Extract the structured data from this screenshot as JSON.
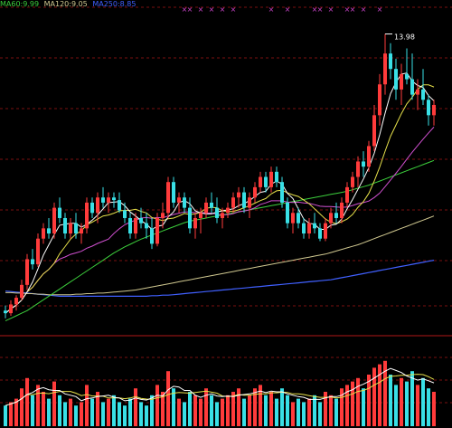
{
  "legend": {
    "ma60": "MA60:9.99",
    "ma120": "MA120:9.05",
    "ma250": "MA250:8.85"
  },
  "colors": {
    "background": "#000000",
    "grid": "#7a1010",
    "divider": "#b01818",
    "up": "#ff3b3b",
    "down": "#39e0e6",
    "ma5": "#ffffff",
    "ma10": "#e6e04a",
    "ma20": "#d050d0",
    "ma60": "#3ccf3c",
    "ma120": "#d0c890",
    "ma250": "#4060ff",
    "marker": "#cc44cc"
  },
  "chart_data": {
    "type": "candlestick",
    "peak_label": "13.98",
    "ylim": [
      8.2,
      14.5
    ],
    "candles": [
      [
        8.6,
        8.7,
        8.45,
        8.55
      ],
      [
        8.55,
        8.8,
        8.5,
        8.72
      ],
      [
        8.72,
        8.9,
        8.6,
        8.85
      ],
      [
        8.85,
        9.2,
        8.8,
        9.1
      ],
      [
        9.1,
        9.7,
        9.0,
        9.6
      ],
      [
        9.6,
        9.8,
        9.4,
        9.5
      ],
      [
        9.5,
        10.1,
        9.45,
        10.0
      ],
      [
        10.0,
        10.3,
        9.9,
        10.2
      ],
      [
        10.2,
        10.4,
        10.0,
        10.1
      ],
      [
        10.1,
        10.7,
        10.0,
        10.6
      ],
      [
        10.6,
        10.8,
        10.3,
        10.4
      ],
      [
        10.4,
        10.5,
        10.0,
        10.1
      ],
      [
        10.1,
        10.4,
        10.0,
        10.3
      ],
      [
        10.3,
        10.5,
        10.0,
        10.1
      ],
      [
        10.1,
        10.3,
        9.9,
        10.2
      ],
      [
        10.2,
        10.8,
        10.1,
        10.7
      ],
      [
        10.7,
        10.8,
        10.4,
        10.5
      ],
      [
        10.5,
        10.9,
        10.3,
        10.8
      ],
      [
        10.8,
        11.0,
        10.6,
        10.7
      ],
      [
        10.7,
        10.9,
        10.5,
        10.8
      ],
      [
        10.8,
        10.9,
        10.6,
        10.75
      ],
      [
        10.75,
        10.9,
        10.5,
        10.55
      ],
      [
        10.55,
        10.7,
        10.3,
        10.4
      ],
      [
        10.4,
        10.5,
        10.0,
        10.1
      ],
      [
        10.1,
        10.5,
        10.0,
        10.4
      ],
      [
        10.4,
        10.6,
        10.2,
        10.3
      ],
      [
        10.3,
        10.5,
        10.0,
        10.2
      ],
      [
        10.2,
        10.4,
        9.8,
        9.9
      ],
      [
        9.9,
        10.5,
        9.85,
        10.4
      ],
      [
        10.4,
        10.7,
        10.2,
        10.5
      ],
      [
        10.5,
        11.2,
        10.4,
        11.1
      ],
      [
        11.1,
        11.2,
        10.6,
        10.7
      ],
      [
        10.7,
        10.9,
        10.5,
        10.8
      ],
      [
        10.8,
        10.9,
        10.5,
        10.6
      ],
      [
        10.6,
        10.8,
        10.1,
        10.2
      ],
      [
        10.2,
        10.5,
        10.0,
        10.4
      ],
      [
        10.4,
        10.6,
        10.1,
        10.5
      ],
      [
        10.5,
        10.8,
        10.4,
        10.7
      ],
      [
        10.7,
        10.9,
        10.5,
        10.6
      ],
      [
        10.6,
        10.8,
        10.3,
        10.4
      ],
      [
        10.4,
        10.6,
        10.2,
        10.5
      ],
      [
        10.5,
        10.7,
        10.4,
        10.6
      ],
      [
        10.6,
        10.9,
        10.5,
        10.8
      ],
      [
        10.8,
        11.0,
        10.6,
        10.9
      ],
      [
        10.9,
        11.0,
        10.5,
        10.6
      ],
      [
        10.6,
        10.9,
        10.4,
        10.8
      ],
      [
        10.8,
        11.1,
        10.7,
        11.0
      ],
      [
        11.0,
        11.3,
        10.9,
        11.2
      ],
      [
        11.2,
        11.3,
        10.9,
        11.0
      ],
      [
        11.0,
        11.4,
        10.9,
        11.3
      ],
      [
        11.3,
        11.4,
        11.0,
        11.1
      ],
      [
        11.1,
        11.2,
        10.6,
        10.7
      ],
      [
        10.7,
        10.8,
        10.2,
        10.3
      ],
      [
        10.3,
        10.6,
        10.1,
        10.5
      ],
      [
        10.5,
        10.6,
        10.2,
        10.3
      ],
      [
        10.3,
        10.4,
        10.0,
        10.1
      ],
      [
        10.1,
        10.4,
        10.0,
        10.3
      ],
      [
        10.3,
        10.5,
        10.1,
        10.2
      ],
      [
        10.2,
        10.3,
        9.95,
        10.0
      ],
      [
        10.0,
        10.4,
        9.95,
        10.3
      ],
      [
        10.3,
        10.6,
        10.2,
        10.5
      ],
      [
        10.5,
        10.7,
        10.3,
        10.4
      ],
      [
        10.4,
        10.8,
        10.3,
        10.7
      ],
      [
        10.7,
        11.1,
        10.6,
        11.0
      ],
      [
        11.0,
        11.3,
        10.9,
        11.2
      ],
      [
        11.2,
        11.6,
        11.0,
        11.5
      ],
      [
        11.5,
        11.7,
        11.2,
        11.4
      ],
      [
        11.4,
        11.9,
        11.3,
        11.8
      ],
      [
        11.8,
        12.6,
        11.7,
        12.4
      ],
      [
        12.4,
        13.2,
        12.2,
        13.0
      ],
      [
        13.0,
        13.98,
        12.8,
        13.6
      ],
      [
        13.6,
        13.8,
        13.1,
        13.3
      ],
      [
        13.3,
        13.5,
        12.7,
        12.9
      ],
      [
        12.9,
        13.4,
        12.6,
        13.2
      ],
      [
        13.2,
        13.7,
        13.0,
        13.1
      ],
      [
        13.1,
        13.6,
        12.7,
        12.8
      ],
      [
        12.8,
        13.1,
        12.5,
        12.9
      ],
      [
        12.9,
        13.3,
        12.6,
        12.7
      ],
      [
        12.7,
        12.8,
        12.2,
        12.4
      ],
      [
        12.4,
        12.7,
        12.2,
        12.6
      ]
    ],
    "volume": [
      30,
      35,
      40,
      55,
      70,
      45,
      60,
      50,
      40,
      65,
      45,
      35,
      40,
      30,
      35,
      60,
      40,
      50,
      35,
      40,
      45,
      35,
      30,
      40,
      55,
      35,
      30,
      45,
      60,
      50,
      80,
      55,
      40,
      35,
      50,
      45,
      40,
      55,
      45,
      35,
      40,
      45,
      50,
      55,
      40,
      45,
      55,
      60,
      45,
      50,
      40,
      55,
      45,
      35,
      40,
      35,
      40,
      45,
      35,
      50,
      45,
      40,
      55,
      60,
      65,
      70,
      55,
      75,
      85,
      90,
      95,
      75,
      60,
      70,
      65,
      80,
      60,
      70,
      55,
      50
    ],
    "volume_max": 100,
    "ma60": [
      8.4,
      8.45,
      8.5,
      8.55,
      8.6,
      8.67,
      8.74,
      8.81,
      8.88,
      8.95,
      9.02,
      9.09,
      9.16,
      9.23,
      9.3,
      9.37,
      9.44,
      9.51,
      9.58,
      9.65,
      9.72,
      9.78,
      9.84,
      9.89,
      9.94,
      9.99,
      10.03,
      10.07,
      10.11,
      10.15,
      10.19,
      10.23,
      10.27,
      10.31,
      10.34,
      10.36,
      10.38,
      10.4,
      10.42,
      10.44,
      10.46,
      10.48,
      10.5,
      10.52,
      10.54,
      10.56,
      10.58,
      10.6,
      10.62,
      10.64,
      10.66,
      10.68,
      10.7,
      10.72,
      10.74,
      10.76,
      10.78,
      10.8,
      10.82,
      10.84,
      10.86,
      10.88,
      10.9,
      10.92,
      10.95,
      10.98,
      11.01,
      11.04,
      11.08,
      11.12,
      11.16,
      11.2,
      11.24,
      11.28,
      11.32,
      11.36,
      11.4,
      11.44,
      11.48,
      11.52
    ],
    "ma120": [
      8.95,
      8.95,
      8.94,
      8.94,
      8.93,
      8.93,
      8.92,
      8.92,
      8.91,
      8.91,
      8.91,
      8.91,
      8.91,
      8.92,
      8.92,
      8.93,
      8.93,
      8.94,
      8.94,
      8.95,
      8.96,
      8.97,
      8.98,
      8.99,
      9.0,
      9.02,
      9.04,
      9.06,
      9.08,
      9.1,
      9.12,
      9.14,
      9.16,
      9.18,
      9.2,
      9.22,
      9.24,
      9.26,
      9.28,
      9.3,
      9.32,
      9.34,
      9.36,
      9.38,
      9.4,
      9.42,
      9.44,
      9.46,
      9.48,
      9.5,
      9.52,
      9.54,
      9.56,
      9.58,
      9.6,
      9.62,
      9.64,
      9.66,
      9.68,
      9.7,
      9.73,
      9.76,
      9.79,
      9.82,
      9.85,
      9.88,
      9.92,
      9.96,
      10.0,
      10.04,
      10.08,
      10.12,
      10.16,
      10.2,
      10.24,
      10.28,
      10.32,
      10.36,
      10.4,
      10.44
    ],
    "ma250": [
      8.98,
      8.97,
      8.96,
      8.95,
      8.94,
      8.93,
      8.92,
      8.91,
      8.9,
      8.89,
      8.88,
      8.88,
      8.88,
      8.88,
      8.88,
      8.88,
      8.88,
      8.88,
      8.88,
      8.88,
      8.88,
      8.88,
      8.88,
      8.88,
      8.88,
      8.88,
      8.88,
      8.89,
      8.89,
      8.9,
      8.9,
      8.91,
      8.92,
      8.93,
      8.94,
      8.95,
      8.96,
      8.97,
      8.98,
      8.99,
      9.0,
      9.01,
      9.02,
      9.03,
      9.04,
      9.05,
      9.06,
      9.07,
      9.08,
      9.09,
      9.1,
      9.11,
      9.12,
      9.13,
      9.14,
      9.15,
      9.16,
      9.17,
      9.18,
      9.19,
      9.2,
      9.22,
      9.24,
      9.26,
      9.28,
      9.3,
      9.32,
      9.34,
      9.36,
      9.38,
      9.4,
      9.42,
      9.44,
      9.46,
      9.48,
      9.5,
      9.52,
      9.54,
      9.56,
      9.58
    ],
    "marker_columns": [
      33,
      34,
      36,
      38,
      40,
      42,
      49,
      52,
      57,
      58,
      60,
      63,
      64,
      66,
      69
    ]
  }
}
